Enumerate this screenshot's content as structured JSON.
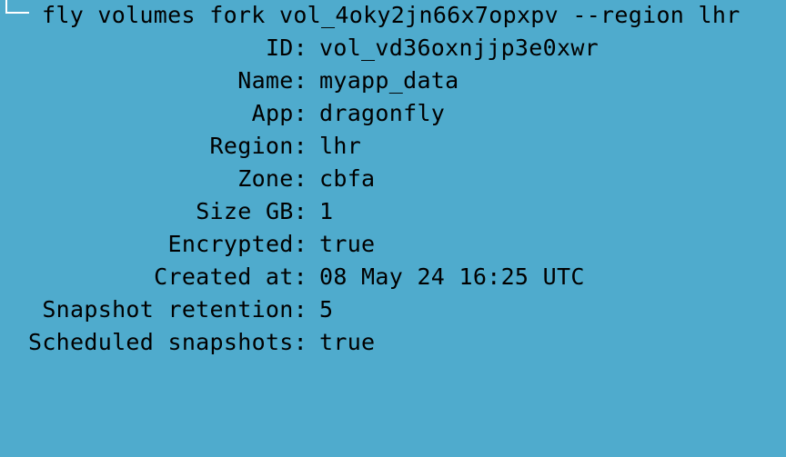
{
  "terminal": {
    "background_color": "#4fabcd",
    "text_color": "#000000",
    "command": "fly volumes fork vol_4oky2jn66x7opxpv --region lhr",
    "fields": [
      {
        "label": "ID:",
        "value": "vol_vd36oxnjjp3e0xwr"
      },
      {
        "label": "Name:",
        "value": "myapp_data"
      },
      {
        "label": "App:",
        "value": "dragonfly"
      },
      {
        "label": "Region:",
        "value": "lhr"
      },
      {
        "label": "Zone:",
        "value": "cbfa"
      },
      {
        "label": "Size GB:",
        "value": "1"
      },
      {
        "label": "Encrypted:",
        "value": "true"
      },
      {
        "label": "Created at:",
        "value": "08 May 24 16:25 UTC"
      },
      {
        "label": "Snapshot retention:",
        "value": "5"
      },
      {
        "label": "Scheduled snapshots:",
        "value": "true"
      }
    ]
  }
}
